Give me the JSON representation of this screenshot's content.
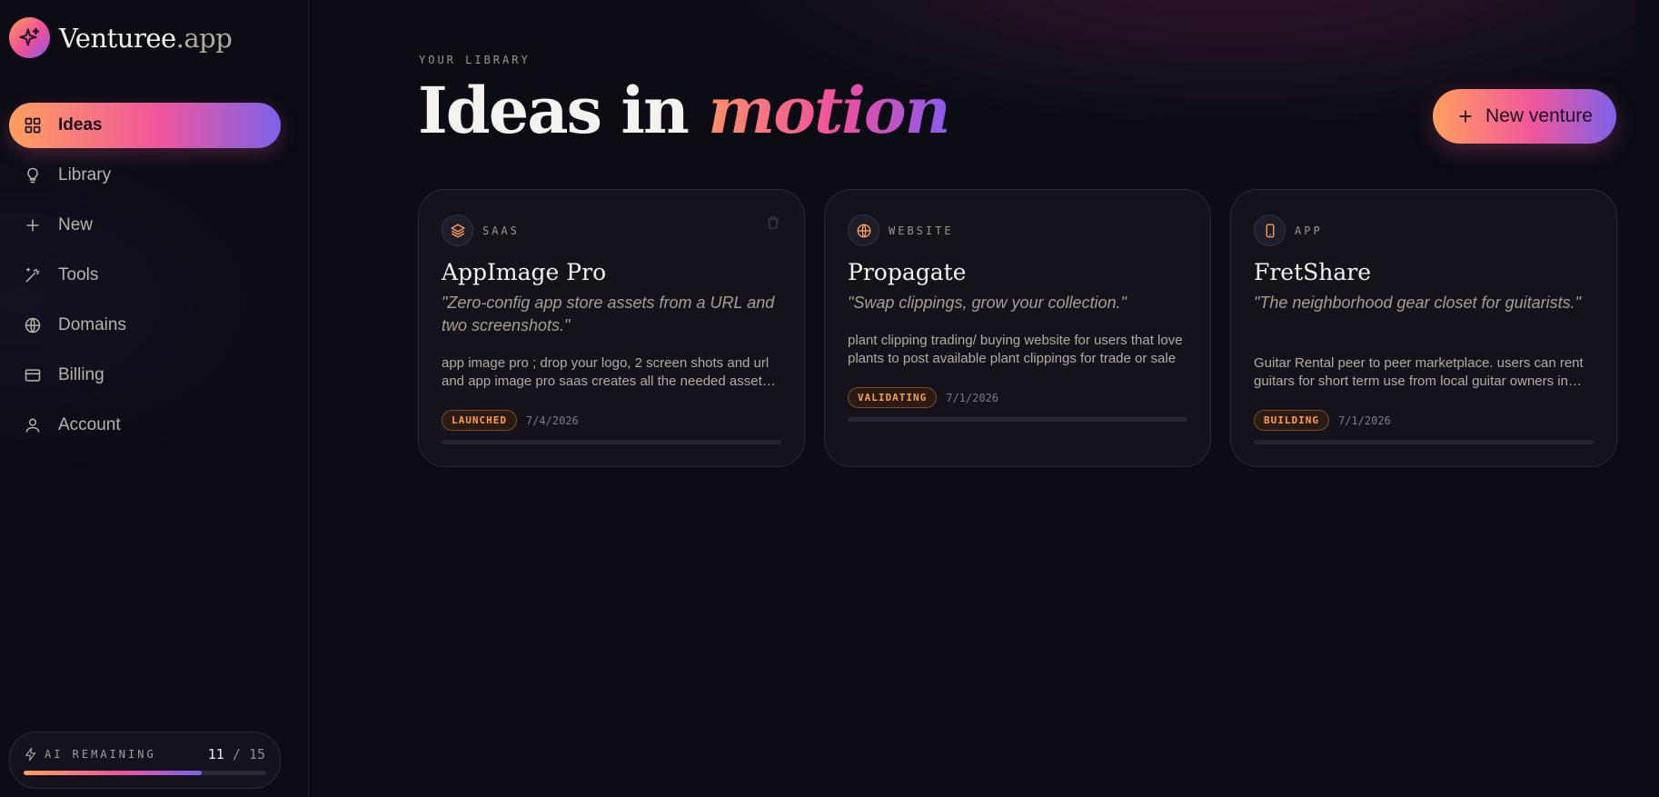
{
  "brand": {
    "name": "Venturee",
    "suffix": ".app"
  },
  "sidebar": {
    "items": [
      {
        "label": "Ideas",
        "icon": "grid-icon",
        "active": true
      },
      {
        "label": "Library",
        "icon": "lightbulb-icon",
        "active": false
      },
      {
        "label": "New",
        "icon": "plus-icon",
        "active": false
      },
      {
        "label": "Tools",
        "icon": "magic-wand-icon",
        "active": false
      },
      {
        "label": "Domains",
        "icon": "globe-icon",
        "active": false
      },
      {
        "label": "Billing",
        "icon": "credit-card-icon",
        "active": false
      },
      {
        "label": "Account",
        "icon": "user-icon",
        "active": false
      }
    ],
    "ai": {
      "label": "AI REMAINING",
      "used": "11",
      "separator": "/",
      "total": "15",
      "fraction": 0.733
    }
  },
  "header": {
    "eyebrow": "YOUR LIBRARY",
    "title_plain": "Ideas in ",
    "title_accent": "motion",
    "new_button": "New venture"
  },
  "cards": [
    {
      "type": "SAAS",
      "type_icon": "layers-icon",
      "title": "AppImage Pro",
      "tagline": "\"Zero-config app store assets from a URL and two screenshots.\"",
      "description": "app image pro ; drop your logo, 2 screen shots and url and app image pro saas creates all the needed assets for the app store listing",
      "status": "LAUNCHED",
      "date": "7/4/2026",
      "progress": 0
    },
    {
      "type": "WEBSITE",
      "type_icon": "globe-icon",
      "title": "Propagate",
      "tagline": "\"Swap clippings, grow your collection.\"",
      "description": "plant clipping trading/ buying website for users that love plants to post available plant clippings for trade or sale",
      "status": "VALIDATING",
      "date": "7/1/2026",
      "progress": 0
    },
    {
      "type": "APP",
      "type_icon": "phone-icon",
      "title": "FretShare",
      "tagline": "\"The neighborhood gear closet for guitarists.\"",
      "description": "Guitar Rental peer to peer marketplace. users can rent guitars for short term use from local guitar owners in their area",
      "status": "BUILDING",
      "date": "7/1/2026",
      "progress": 0
    }
  ],
  "colors": {
    "accent_orange": "#ff9f5e",
    "accent_pink": "#f0569b",
    "accent_purple": "#7d62ea",
    "background": "#0c0c14"
  }
}
